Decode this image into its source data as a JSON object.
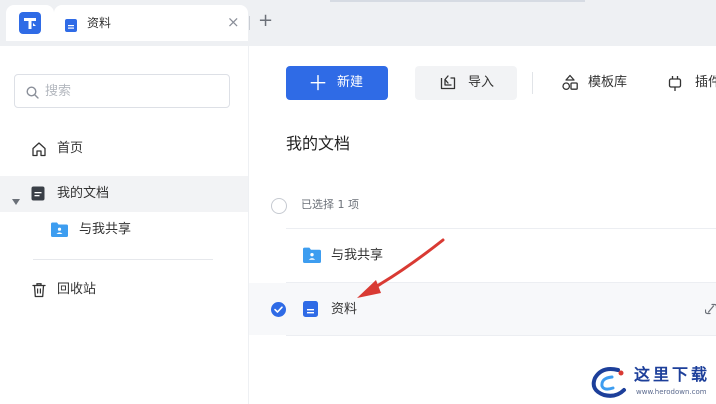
{
  "tab_bar": {
    "active_tab_title": "资料",
    "close_glyph": "×",
    "new_tab_glyph": "+"
  },
  "sidebar": {
    "search_placeholder": "搜索",
    "items": [
      {
        "label": "首页",
        "icon": "home-icon"
      },
      {
        "label": "我的文档",
        "icon": "document-icon",
        "active": true,
        "expanded": true
      },
      {
        "label": "与我共享",
        "icon": "shared-folder-icon"
      },
      {
        "label": "回收站",
        "icon": "trash-icon"
      }
    ]
  },
  "toolbar": {
    "new_label": "新建",
    "import_label": "导入",
    "template_label": "模板库",
    "plugin_label": "插件"
  },
  "main": {
    "title": "我的文档",
    "selection_count": "已选择 1 项",
    "files": [
      {
        "name": "与我共享",
        "icon": "shared-folder-icon",
        "selected": false
      },
      {
        "name": "资料",
        "icon": "document-icon",
        "selected": true
      }
    ]
  },
  "watermark": {
    "title": "这里下载",
    "url": "www.herodown.com"
  },
  "colors": {
    "accent": "#2f6be6",
    "annotation_arrow": "#d93a33",
    "selected_row_bg": "#f7f8fa"
  }
}
